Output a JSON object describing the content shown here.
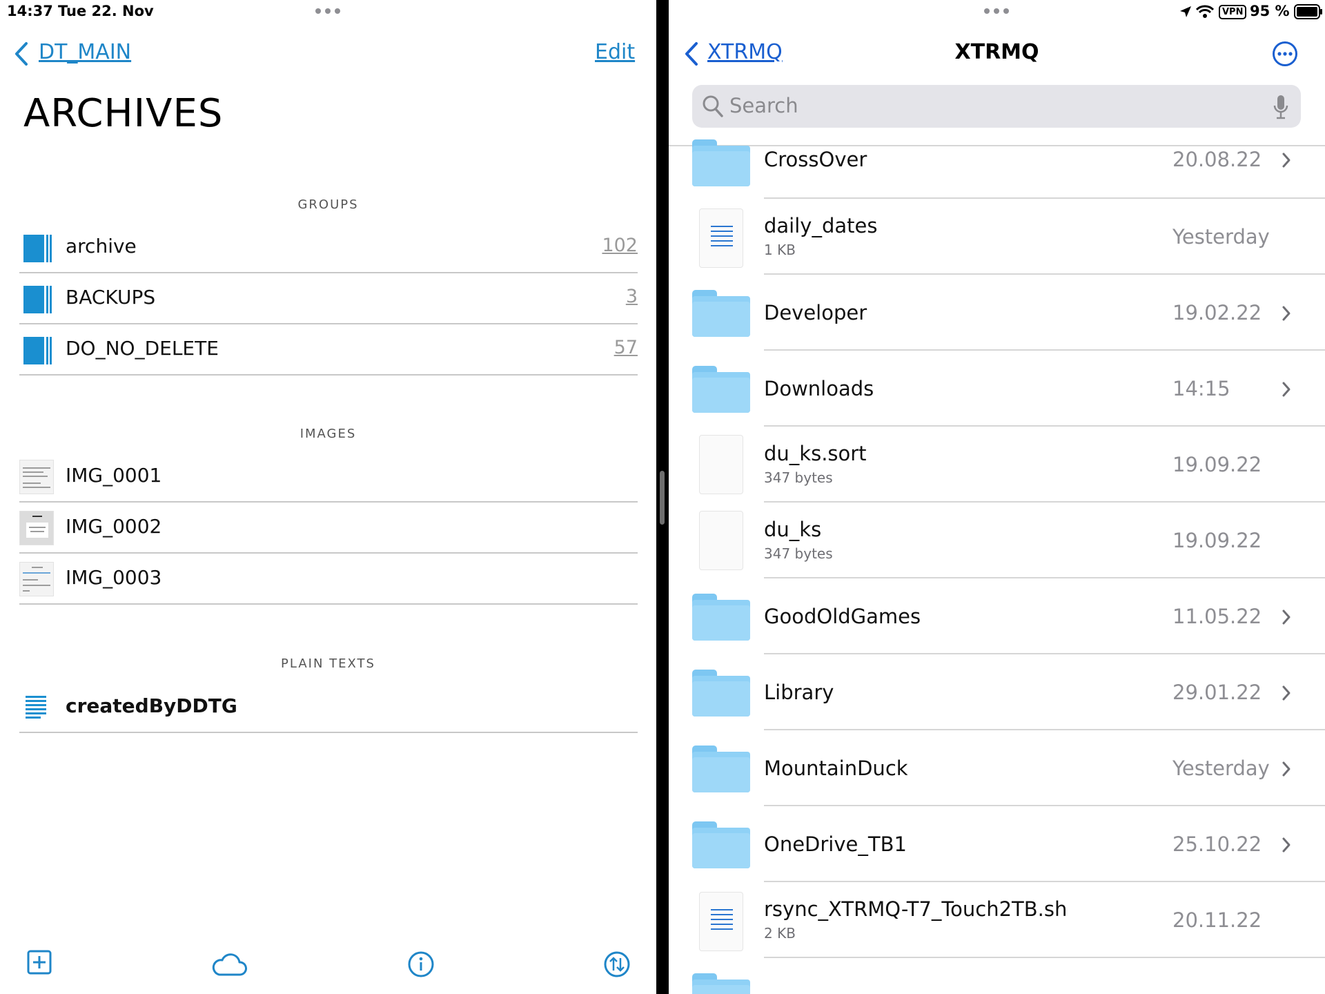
{
  "status_bar": {
    "time": "14:37",
    "date": "Tue 22. Nov",
    "vpn": "VPN",
    "battery": "95 %"
  },
  "left": {
    "nav": {
      "back_label": "DT_MAIN",
      "edit_label": "Edit"
    },
    "title": "ARCHIVES",
    "groups": {
      "header": "GROUPS",
      "items": [
        {
          "label": "archive",
          "count": "102"
        },
        {
          "label": "BACKUPS",
          "count": "3"
        },
        {
          "label": "DO_NO_DELETE",
          "count": "57"
        }
      ]
    },
    "images": {
      "header": "IMAGES",
      "items": [
        {
          "label": "IMG_0001"
        },
        {
          "label": "IMG_0002"
        },
        {
          "label": "IMG_0003"
        }
      ]
    },
    "plain_texts": {
      "header": "PLAIN TEXTS",
      "items": [
        {
          "label": "createdByDDTG"
        }
      ]
    },
    "toolbar": [
      "add-square-icon",
      "cloud-icon",
      "info-icon",
      "sync-arrows-icon"
    ]
  },
  "right": {
    "nav": {
      "back_label": "XTRMQ",
      "title": "XTRMQ"
    },
    "search": {
      "placeholder": "Search"
    },
    "files": [
      {
        "name": "CrossOver",
        "size": "",
        "date": "20.08.22",
        "type": "folder"
      },
      {
        "name": "daily_dates",
        "size": "1 KB",
        "date": "Yesterday",
        "type": "text"
      },
      {
        "name": "Developer",
        "size": "",
        "date": "19.02.22",
        "type": "folder"
      },
      {
        "name": "Downloads",
        "size": "",
        "date": "14:15",
        "type": "folder"
      },
      {
        "name": "du_ks.sort",
        "size": "347 bytes",
        "date": "19.09.22",
        "type": "blank"
      },
      {
        "name": "du_ks",
        "size": "347 bytes",
        "date": "19.09.22",
        "type": "blank"
      },
      {
        "name": "GoodOldGames",
        "size": "",
        "date": "11.05.22",
        "type": "folder"
      },
      {
        "name": "Library",
        "size": "",
        "date": "29.01.22",
        "type": "folder"
      },
      {
        "name": "MountainDuck",
        "size": "",
        "date": "Yesterday",
        "type": "folder"
      },
      {
        "name": "OneDrive_TB1",
        "size": "",
        "date": "25.10.22",
        "type": "folder"
      },
      {
        "name": "rsync_XTRMQ-T7_Touch2TB.sh",
        "size": "2 KB",
        "date": "20.11.22",
        "type": "text"
      },
      {
        "name": "",
        "size": "",
        "date": "",
        "type": "folder"
      }
    ]
  },
  "colors": {
    "accent_left": "#1f86c8",
    "accent_right": "#1a5fd0",
    "folder": "#8fd1f6",
    "group_icon": "#1a8fd0"
  }
}
